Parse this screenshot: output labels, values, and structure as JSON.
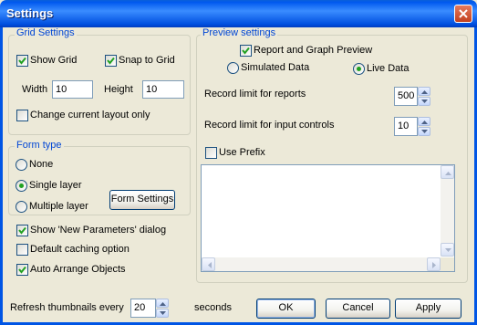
{
  "window": {
    "title": "Settings"
  },
  "grid_settings": {
    "legend": "Grid Settings",
    "show_grid": {
      "label": "Show Grid",
      "checked": true
    },
    "snap_to_grid": {
      "label": "Snap to Grid",
      "checked": true
    },
    "width": {
      "label": "Width",
      "value": "10"
    },
    "height": {
      "label": "Height",
      "value": "10"
    },
    "change_layout_only": {
      "label": "Change current layout only",
      "checked": false
    }
  },
  "form_type": {
    "legend": "Form type",
    "options": [
      {
        "label": "None",
        "selected": false
      },
      {
        "label": "Single layer",
        "selected": true
      },
      {
        "label": "Multiple layer",
        "selected": false
      }
    ],
    "form_settings_button": "Form Settings"
  },
  "options": {
    "show_new_parameters": {
      "label": "Show 'New Parameters' dialog",
      "checked": true
    },
    "default_caching": {
      "label": "Default caching option",
      "checked": false
    },
    "auto_arrange": {
      "label": "Auto Arrange Objects",
      "checked": true
    }
  },
  "preview_settings": {
    "legend": "Preview settings",
    "report_graph_preview": {
      "label": "Report and Graph Preview",
      "checked": true
    },
    "simulated_data": {
      "label": "Simulated Data",
      "selected": false
    },
    "live_data": {
      "label": "Live Data",
      "selected": true
    },
    "record_limit_reports": {
      "label": "Record limit for reports",
      "value": "500"
    },
    "record_limit_inputs": {
      "label": "Record limit for input controls",
      "value": "10"
    },
    "use_prefix": {
      "label": "Use Prefix",
      "checked": false
    }
  },
  "footer": {
    "refresh_label": "Refresh thumbnails every",
    "refresh_value": "20",
    "refresh_unit": "seconds",
    "ok": "OK",
    "cancel": "Cancel",
    "apply": "Apply"
  }
}
